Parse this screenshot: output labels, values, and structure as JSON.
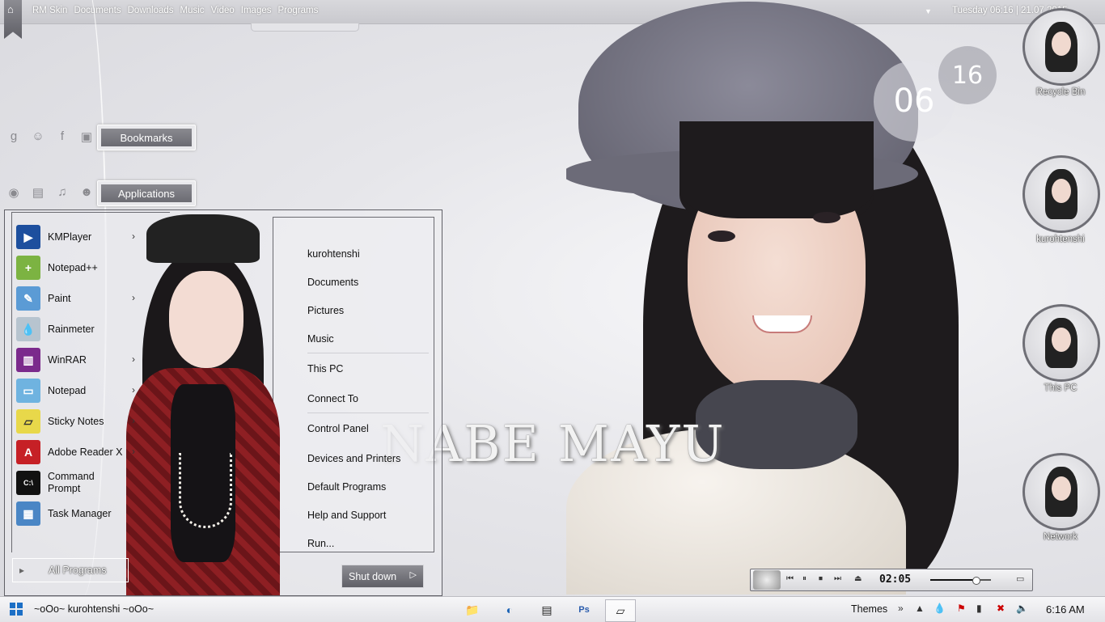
{
  "topbar": {
    "links": [
      "RM Skin",
      "Documents",
      "Downloads",
      "Music",
      "Video",
      "Images",
      "Programs"
    ],
    "datetime": "Tuesday 06:16 | 21.07.2015"
  },
  "docks": {
    "bookmarks_label": "Bookmarks",
    "applications_label": "Applications"
  },
  "clock": {
    "hour": "06",
    "minute": "16"
  },
  "wallpaper": {
    "name_text": "NABE MAYU"
  },
  "startmenu": {
    "apps": [
      {
        "label": "KMPlayer",
        "icon": "kmplayer-icon",
        "has_submenu": true
      },
      {
        "label": "Notepad++",
        "icon": "notepadpp-icon",
        "has_submenu": false
      },
      {
        "label": "Paint",
        "icon": "paint-icon",
        "has_submenu": true
      },
      {
        "label": "Rainmeter",
        "icon": "rainmeter-icon",
        "has_submenu": false
      },
      {
        "label": "WinRAR",
        "icon": "winrar-icon",
        "has_submenu": true
      },
      {
        "label": "Notepad",
        "icon": "notepad-icon",
        "has_submenu": true
      },
      {
        "label": "Sticky Notes",
        "icon": "sticky-notes-icon",
        "has_submenu": true
      },
      {
        "label": "Adobe Reader X",
        "icon": "adobe-reader-icon",
        "has_submenu": true
      },
      {
        "label": "Command Prompt",
        "icon": "command-prompt-icon",
        "has_submenu": false
      },
      {
        "label": "Task Manager",
        "icon": "task-manager-icon",
        "has_submenu": false
      }
    ],
    "places": [
      "kurohtenshi",
      "Documents",
      "Pictures",
      "Music",
      "This PC",
      "Connect To",
      "Control Panel",
      "Devices and Printers",
      "Default Programs",
      "Help and Support",
      "Run..."
    ],
    "all_programs_label": "All Programs",
    "shutdown_label": "Shut down"
  },
  "desktop_icons": [
    {
      "label": "Recycle Bin"
    },
    {
      "label": "kurohtenshi"
    },
    {
      "label": "This PC"
    },
    {
      "label": "Network"
    }
  ],
  "player": {
    "time": "02:05",
    "volume": 0.75
  },
  "taskbar": {
    "title": "~oOo~ kurohtenshi ~oOo~",
    "themes_label": "Themes",
    "clock": "6:16 AM"
  },
  "colors": {
    "accent": "#1c6fc6",
    "dock_button": "#6b6b72"
  }
}
